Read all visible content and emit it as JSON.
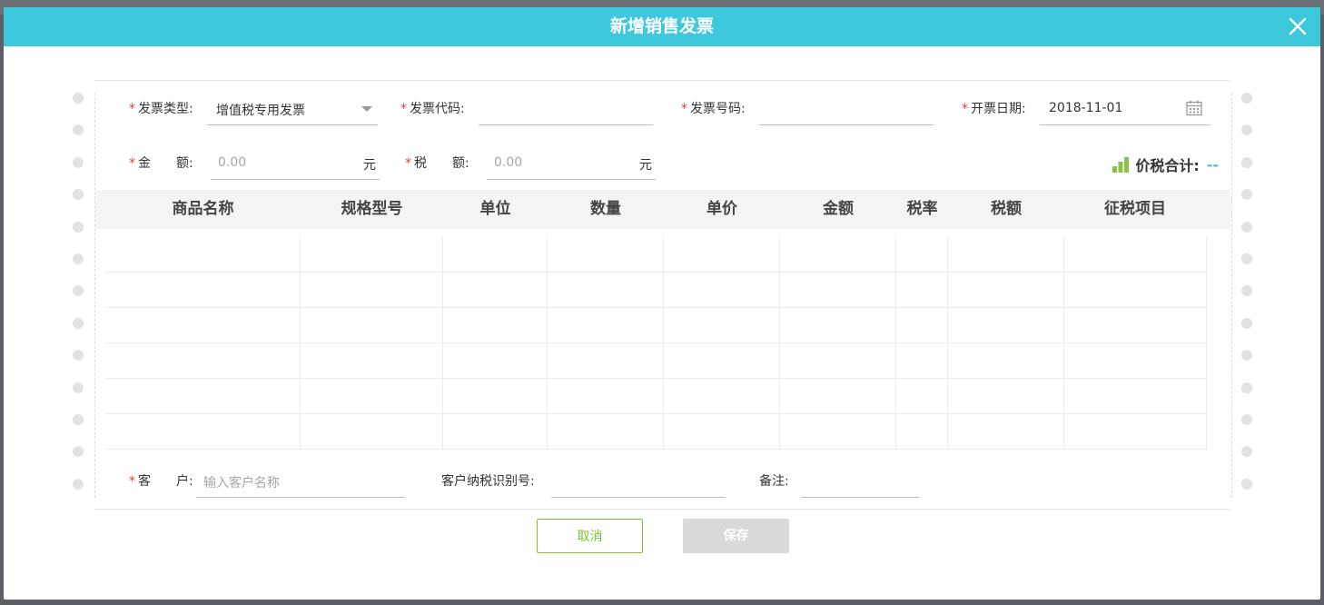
{
  "dialog": {
    "title": "新增销售发票",
    "close_icon": "close-icon"
  },
  "form": {
    "required_mark": "*",
    "invoice_type": {
      "label": "发票类型:",
      "value": "增值税专用发票"
    },
    "invoice_code": {
      "label": "发票代码:",
      "value": ""
    },
    "invoice_number": {
      "label": "发票号码:",
      "value": ""
    },
    "invoice_date": {
      "label": "开票日期:",
      "value": "2018-11-01",
      "icon": "calendar-icon"
    },
    "amount": {
      "label": "金　　额:",
      "placeholder": "0.00",
      "unit": "元"
    },
    "tax": {
      "label": "税　　额:",
      "placeholder": "0.00",
      "unit": "元"
    },
    "total": {
      "label": "价税合计:",
      "value": "--",
      "icon": "bar-chart-icon"
    },
    "customer": {
      "label": "客　　户:",
      "placeholder": "输入客户名称"
    },
    "customer_tax_id": {
      "label": "客户纳税识别号:",
      "value": ""
    },
    "remark": {
      "label": "备注:",
      "value": ""
    }
  },
  "table": {
    "columns": [
      "商品名称",
      "规格型号",
      "单位",
      "数量",
      "单价",
      "金额",
      "税率",
      "税额",
      "征税项目"
    ],
    "rows": 6
  },
  "buttons": {
    "cancel": "取消",
    "save": "保存"
  },
  "colors": {
    "header": "#3ec8dc",
    "required": "#e23b3b",
    "cancel_border": "#7cc233",
    "save_disabled": "#d9d9d9",
    "total_icon": "#8bc34a"
  }
}
